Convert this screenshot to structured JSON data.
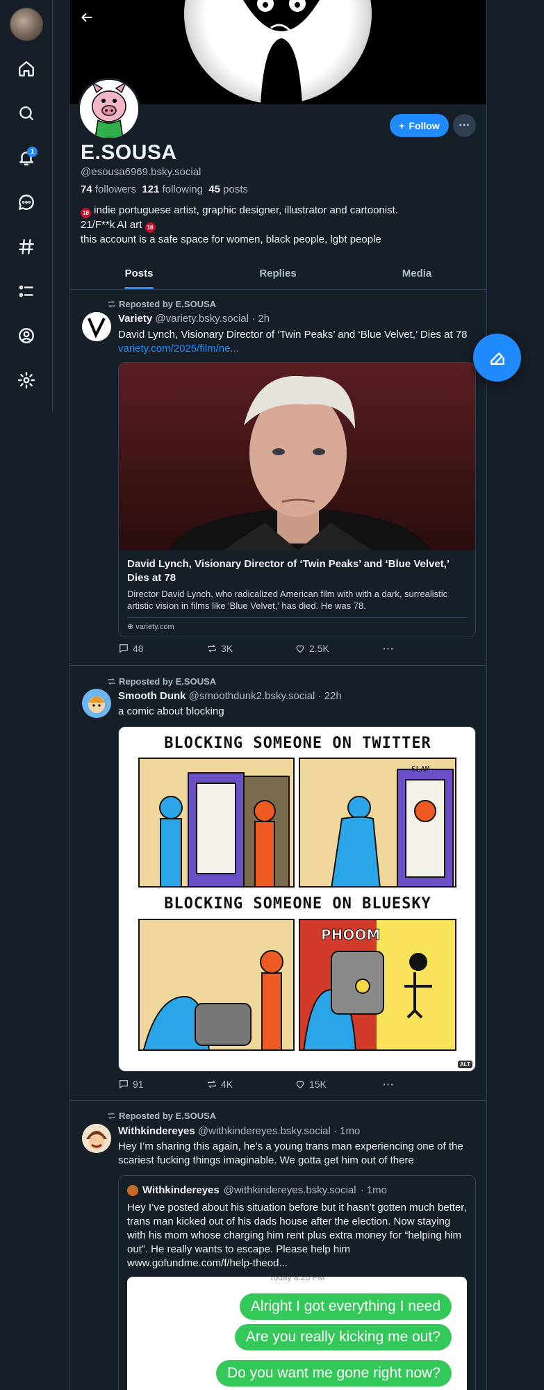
{
  "nav": {
    "notifications_badge": "1",
    "items": [
      "home",
      "search",
      "notifications",
      "chat",
      "feeds",
      "lists",
      "profile",
      "settings"
    ]
  },
  "profile": {
    "display_name": "E.SOUSA",
    "handle": "@esousa6969.bsky.social",
    "followers_count": "74",
    "followers_label": "followers",
    "following_count": "121",
    "following_label": "following",
    "posts_count": "45",
    "posts_label": "posts",
    "bio_line1": "indie portuguese artist, graphic designer, illustrator and cartoonist.",
    "bio_line2_prefix": "21/F**k AI art",
    "bio_line3": "this account is a safe space for women, black people, lgbt people",
    "badge_18": "18",
    "follow_label": "Follow",
    "more_label": "···"
  },
  "tabs": [
    "Posts",
    "Replies",
    "Media"
  ],
  "posts": [
    {
      "repost_label": "Reposted by E.SOUSA",
      "author": "Variety",
      "handle": "@variety.bsky.social",
      "time": "· 2h",
      "text": "David Lynch, Visionary Director of ‘Twin Peaks’ and ‘Blue Velvet,’ Dies at 78",
      "link": "variety.com/2025/film/ne...",
      "card": {
        "title": "David Lynch, Visionary Director of ‘Twin Peaks’ and ‘Blue Velvet,’ Dies at 78",
        "description": "Director David Lynch, who radicalized American film with with a dark, surrealistic artistic vision in films like 'Blue Velvet,' has died. He was 78.",
        "domain": "variety.com"
      },
      "replies": "48",
      "reposts": "3K",
      "likes": "2.5K"
    },
    {
      "repost_label": "Reposted by E.SOUSA",
      "author": "Smooth Dunk",
      "handle": "@smoothdunk2.bsky.social",
      "time": "· 22h",
      "text": "a comic about blocking",
      "comic": {
        "heading_top": "BLOCKING SOMEONE ON TWITTER",
        "heading_bottom": "BLOCKING SOMEONE ON BLUESKY",
        "sfx_slam": "SLAM",
        "sfx_phoom": "PHOOM",
        "alt": "ALT"
      },
      "replies": "91",
      "reposts": "4K",
      "likes": "15K"
    },
    {
      "repost_label": "Reposted by E.SOUSA",
      "author": "Withkindereyes",
      "handle": "@withkindereyes.bsky.social",
      "time": "· 1mo",
      "text": "Hey I’m sharing this again, he’s a young trans man experiencing one of the scariest fucking things imaginable. We gotta get him out of there",
      "quote": {
        "author": "Withkindereyes",
        "handle": "@withkindereyes.bsky.social",
        "time": "· 1mo",
        "text": "Hey I’ve posted about his situation before but it hasn’t gotten much better, trans man kicked out of his dads house after the election. Now staying with his mom whose charging him rent plus extra money for “helping him out”. He really wants to escape. Please help him www.gofundme.com/f/help-theod...",
        "sms_time": "Today 8:20 PM",
        "bubbles": [
          "Alright I got everything I need",
          "Are you really kicking me out?",
          "Do you want me gone right now?"
        ]
      }
    }
  ],
  "colors": {
    "background": "#161e27",
    "accent": "#208bfe",
    "border": "#2e4052",
    "muted_text": "#aebbc9",
    "sms_bubble": "#34c759"
  }
}
